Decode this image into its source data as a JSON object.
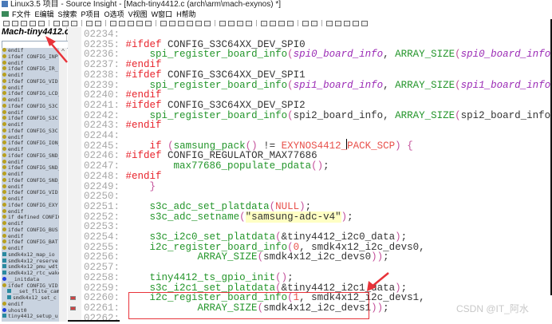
{
  "window": {
    "title": "Linux3.5 项目 - Source Insight - [Mach-tiny4412.c (arch\\arm\\mach-exynos) *]"
  },
  "menu": [
    "F文件",
    "E编辑",
    "S搜索",
    "P项目",
    "O选项",
    "V视图",
    "W窗口",
    "H帮助"
  ],
  "sidebar": {
    "file_title": "Mach-tiny4412.c",
    "modified_mark": "*",
    "search_placeholder": "",
    "scroll_up": "^",
    "items": [
      {
        "t": "endif",
        "k": "pre"
      },
      {
        "t": "ifdef CONFIG_INP",
        "k": "pre"
      },
      {
        "t": "endif",
        "k": "pre"
      },
      {
        "t": "ifdef CONFIG_IR_",
        "k": "pre"
      },
      {
        "t": "endif",
        "k": "pre"
      },
      {
        "t": "ifdef CONFIG_VID",
        "k": "pre"
      },
      {
        "t": "endif",
        "k": "pre"
      },
      {
        "t": "ifdef CONFIG_LCD_",
        "k": "pre"
      },
      {
        "t": "endif",
        "k": "pre"
      },
      {
        "t": "ifdef CONFIG_S3C",
        "k": "pre"
      },
      {
        "t": "endif",
        "k": "pre"
      },
      {
        "t": "ifdef CONFIG_S3C",
        "k": "pre"
      },
      {
        "t": "endif",
        "k": "pre"
      },
      {
        "t": "ifdef CONFIG_S3C",
        "k": "pre"
      },
      {
        "t": "endif",
        "k": "pre"
      },
      {
        "t": "ifdef CONFIG_ION_",
        "k": "pre"
      },
      {
        "t": "endif",
        "k": "pre"
      },
      {
        "t": "ifdef CONFIG_SND_",
        "k": "pre"
      },
      {
        "t": "endif",
        "k": "pre"
      },
      {
        "t": "ifdef CONFIG_SND_",
        "k": "pre"
      },
      {
        "t": "endif",
        "k": "pre"
      },
      {
        "t": "ifdef CONFIG_SND_",
        "k": "pre"
      },
      {
        "t": "endif",
        "k": "pre"
      },
      {
        "t": "ifdef CONFIG_VID",
        "k": "pre"
      },
      {
        "t": "endif",
        "k": "pre"
      },
      {
        "t": "ifdef CONFIG_EXY",
        "k": "pre"
      },
      {
        "t": "endif",
        "k": "pre"
      },
      {
        "t": "if defined CONFIG",
        "k": "pre"
      },
      {
        "t": "endif",
        "k": "pre"
      },
      {
        "t": "ifdef CONFIG_BUS",
        "k": "pre"
      },
      {
        "t": "endif",
        "k": "pre"
      },
      {
        "t": "ifdef CONFIG_BAT",
        "k": "pre"
      },
      {
        "t": "endif",
        "k": "pre"
      },
      {
        "t": "smdk4x12_map_io",
        "k": "fn"
      },
      {
        "t": "smdk4x12_reserve",
        "k": "fn"
      },
      {
        "t": "smdk4x12_pmu_wdt_",
        "k": "fn"
      },
      {
        "t": "smdk4x12_rtc_wake",
        "k": "fn"
      },
      {
        "t": "__initdata",
        "k": "var"
      },
      {
        "t": "ifdef CONFIG_VID",
        "k": "pre"
      },
      {
        "t": "__set_flite_cam",
        "k": "fn",
        "ind": true
      },
      {
        "t": "smdk4x12_set_c",
        "k": "fn",
        "ind": true
      },
      {
        "t": "endif",
        "k": "pre"
      },
      {
        "t": "uhost0",
        "k": "var"
      },
      {
        "t": "tiny4412_setup_u",
        "k": "fn"
      }
    ]
  },
  "editor": {
    "lines": [
      {
        "n": "02234:",
        "tk": []
      },
      {
        "n": "02235:",
        "tk": [
          [
            "dir",
            "#ifdef"
          ],
          [
            "id",
            " CONFIG_S3C64XX_DEV_SPI0"
          ]
        ]
      },
      {
        "n": "02236:",
        "tk": [
          [
            "id",
            "    "
          ],
          [
            "fn",
            "spi_register_board_info"
          ],
          [
            "p",
            "("
          ],
          [
            "it",
            "spi0_board_info"
          ],
          [
            "id",
            ", "
          ],
          [
            "fn",
            "ARRAY_SIZE"
          ],
          [
            "p",
            "("
          ],
          [
            "it",
            "spi0_board_info"
          ],
          [
            "p",
            "))"
          ],
          [
            "id",
            ";"
          ]
        ]
      },
      {
        "n": "02237:",
        "tk": [
          [
            "dir",
            "#endif"
          ]
        ]
      },
      {
        "n": "02238:",
        "tk": [
          [
            "dir",
            "#ifdef"
          ],
          [
            "id",
            " CONFIG_S3C64XX_DEV_SPI1"
          ]
        ]
      },
      {
        "n": "02239:",
        "tk": [
          [
            "id",
            "    "
          ],
          [
            "fn",
            "spi_register_board_info"
          ],
          [
            "p",
            "("
          ],
          [
            "it",
            "spi1_board_info"
          ],
          [
            "id",
            ", "
          ],
          [
            "fn",
            "ARRAY_SIZE"
          ],
          [
            "p",
            "("
          ],
          [
            "it",
            "spi1_board_info"
          ],
          [
            "p",
            "))"
          ],
          [
            "id",
            ";"
          ]
        ]
      },
      {
        "n": "02240:",
        "tk": [
          [
            "dir",
            "#endif"
          ]
        ]
      },
      {
        "n": "02241:",
        "tk": [
          [
            "dir",
            "#ifdef"
          ],
          [
            "id",
            " CONFIG_S3C64XX_DEV_SPI2"
          ]
        ]
      },
      {
        "n": "02242:",
        "tk": [
          [
            "id",
            "    "
          ],
          [
            "fn",
            "spi_register_board_info"
          ],
          [
            "p",
            "("
          ],
          [
            "id",
            "spi2_board_info, "
          ],
          [
            "fn",
            "ARRAY_SIZE"
          ],
          [
            "p",
            "("
          ],
          [
            "id",
            "spi2_board_info"
          ],
          [
            "p",
            "))"
          ],
          [
            "id",
            ";"
          ]
        ]
      },
      {
        "n": "02243:",
        "tk": [
          [
            "dir",
            "#endif"
          ]
        ]
      },
      {
        "n": "02244:",
        "tk": []
      },
      {
        "n": "02245:",
        "tk": [
          [
            "id",
            "    "
          ],
          [
            "kw",
            "if"
          ],
          [
            "id",
            " "
          ],
          [
            "p",
            "("
          ],
          [
            "fn",
            "samsung_pack"
          ],
          [
            "p",
            "()"
          ],
          [
            "id",
            " != "
          ],
          [
            "mac",
            "EXYNOS4412_PACK_SCP"
          ],
          [
            "p",
            ")"
          ],
          [
            "id",
            " "
          ],
          [
            "p",
            "{"
          ]
        ]
      },
      {
        "n": "02246:",
        "tk": [
          [
            "dir",
            "#ifdef"
          ],
          [
            "id",
            " CONFIG_REGULATOR_MAX77686"
          ]
        ]
      },
      {
        "n": "02247:",
        "tk": [
          [
            "id",
            "        "
          ],
          [
            "fn",
            "max77686_populate_pdata"
          ],
          [
            "p",
            "()"
          ],
          [
            "id",
            ";"
          ]
        ]
      },
      {
        "n": "02248:",
        "tk": [
          [
            "dir",
            "#endif"
          ]
        ]
      },
      {
        "n": "02249:",
        "tk": [
          [
            "id",
            "    "
          ],
          [
            "p",
            "}"
          ]
        ]
      },
      {
        "n": "02250:",
        "tk": []
      },
      {
        "n": "02251:",
        "tk": [
          [
            "id",
            "    "
          ],
          [
            "fn",
            "s3c_adc_set_platdata"
          ],
          [
            "p",
            "("
          ],
          [
            "mac",
            "NULL"
          ],
          [
            "p",
            ")"
          ],
          [
            "id",
            ";"
          ]
        ]
      },
      {
        "n": "02252:",
        "tk": [
          [
            "id",
            "    "
          ],
          [
            "fn",
            "s3c_adc_setname"
          ],
          [
            "p",
            "("
          ],
          [
            "str",
            "\"samsung-adc-v4\""
          ],
          [
            "p",
            ")"
          ],
          [
            "id",
            ";"
          ]
        ]
      },
      {
        "n": "02253:",
        "tk": []
      },
      {
        "n": "02254:",
        "tk": [
          [
            "id",
            "    "
          ],
          [
            "fn",
            "s3c_i2c0_set_platdata"
          ],
          [
            "p",
            "("
          ],
          [
            "id",
            "&tiny4412_i2c0_data"
          ],
          [
            "p",
            ")"
          ],
          [
            "id",
            ";"
          ]
        ]
      },
      {
        "n": "02255:",
        "tk": [
          [
            "id",
            "    "
          ],
          [
            "fn",
            "i2c_register_board_info"
          ],
          [
            "p",
            "("
          ],
          [
            "num",
            "0"
          ],
          [
            "id",
            ", smdk4x12_i2c_devs0,"
          ]
        ]
      },
      {
        "n": "02256:",
        "tk": [
          [
            "id",
            "            "
          ],
          [
            "fn",
            "ARRAY_SIZE"
          ],
          [
            "p",
            "("
          ],
          [
            "id",
            "smdk4x12_i2c_devs0"
          ],
          [
            "p",
            "))"
          ],
          [
            "id",
            ";"
          ]
        ]
      },
      {
        "n": "02257:",
        "tk": []
      },
      {
        "n": "02258:",
        "tk": [
          [
            "id",
            "    "
          ],
          [
            "fn",
            "tiny4412_ts_gpio_init"
          ],
          [
            "p",
            "()"
          ],
          [
            "id",
            ";"
          ]
        ]
      },
      {
        "n": "02259:",
        "tk": [
          [
            "id",
            "    "
          ],
          [
            "fn",
            "s3c_i2c1_set_platdata"
          ],
          [
            "p",
            "("
          ],
          [
            "id",
            "&tiny4412_i2c1_data"
          ],
          [
            "p",
            ")"
          ],
          [
            "id",
            ";"
          ]
        ]
      },
      {
        "n": "02260:",
        "tk": [
          [
            "id",
            "    "
          ],
          [
            "fn",
            "i2c_register_board_info"
          ],
          [
            "p",
            "("
          ],
          [
            "num",
            "1"
          ],
          [
            "id",
            ", smdk4x12_i2c_devs1,"
          ]
        ],
        "mark": true
      },
      {
        "n": "02261:",
        "tk": [
          [
            "id",
            "            "
          ],
          [
            "fn",
            "ARRAY_SIZE"
          ],
          [
            "p",
            "("
          ],
          [
            "id",
            "smdk4x12_i2c_devs1"
          ],
          [
            "p",
            "))"
          ],
          [
            "id",
            ";"
          ]
        ],
        "mark": true
      },
      {
        "n": "02262:",
        "tk": []
      }
    ]
  },
  "watermark": "CSDN @IT_阿水",
  "colors": {
    "directive": "#e8232b",
    "function": "#23952a",
    "annotation": "#e8333a"
  }
}
